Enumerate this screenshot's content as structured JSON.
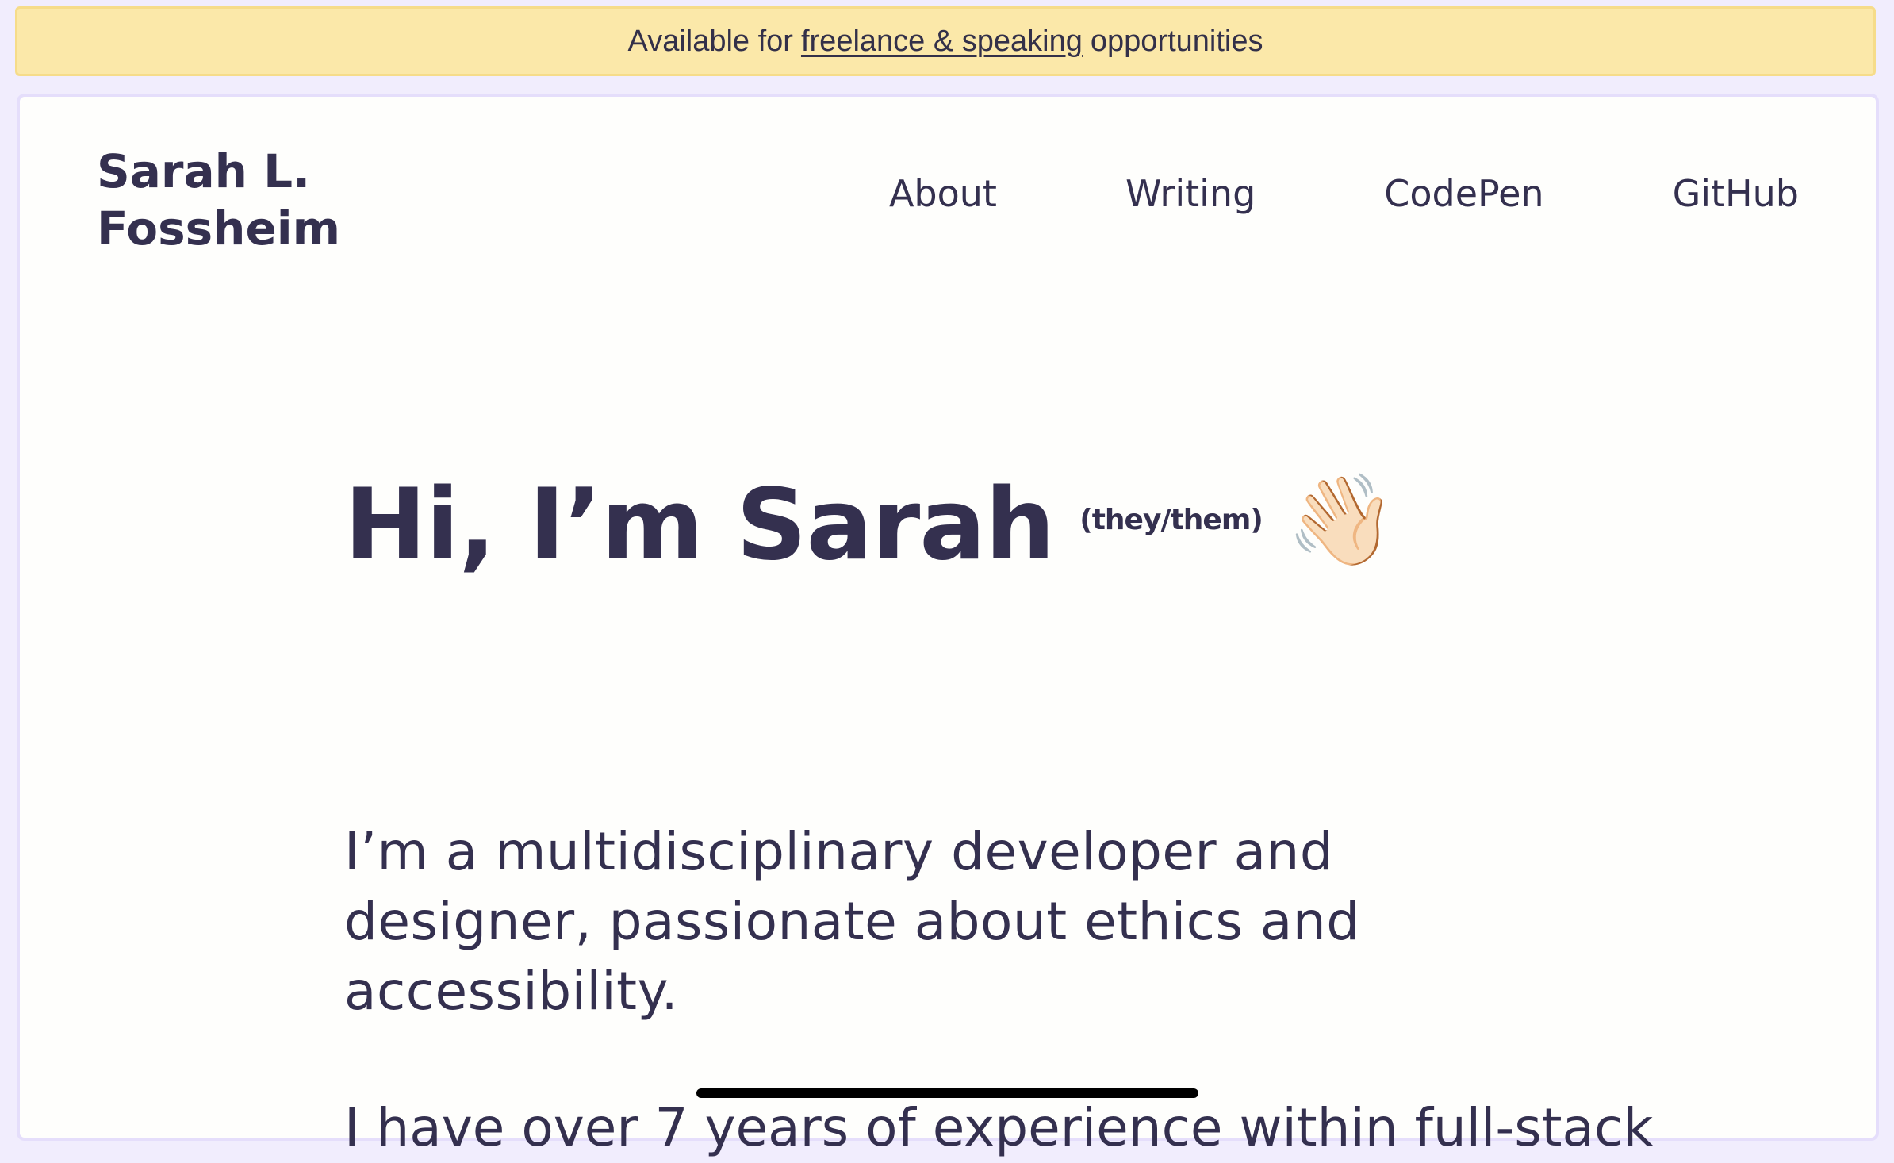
{
  "banner": {
    "prefix": "Available for",
    "link": "freelance & speaking",
    "suffix": "opportunities"
  },
  "logo": {
    "line1": "Sarah L.",
    "line2": "Fossheim"
  },
  "nav": {
    "items": [
      "About",
      "Writing",
      "CodePen",
      "GitHub"
    ]
  },
  "hero": {
    "heading": "Hi, I’m Sarah",
    "pronouns": "they/them",
    "wave_emoji": "👋🏻",
    "intro": "I’m a multidisciplinary developer and designer, passionate about ethics and accessibility.",
    "next_line_partial": "I have over 7 years of experience within full-stack"
  },
  "colors": {
    "page_background": "#f1edfd",
    "banner_background": "#fbe8a9",
    "card_background": "#fefefc",
    "text": "#34304f",
    "highlight_yellow": "#fbe8a9",
    "highlight_purple": "#ddd2fc"
  }
}
